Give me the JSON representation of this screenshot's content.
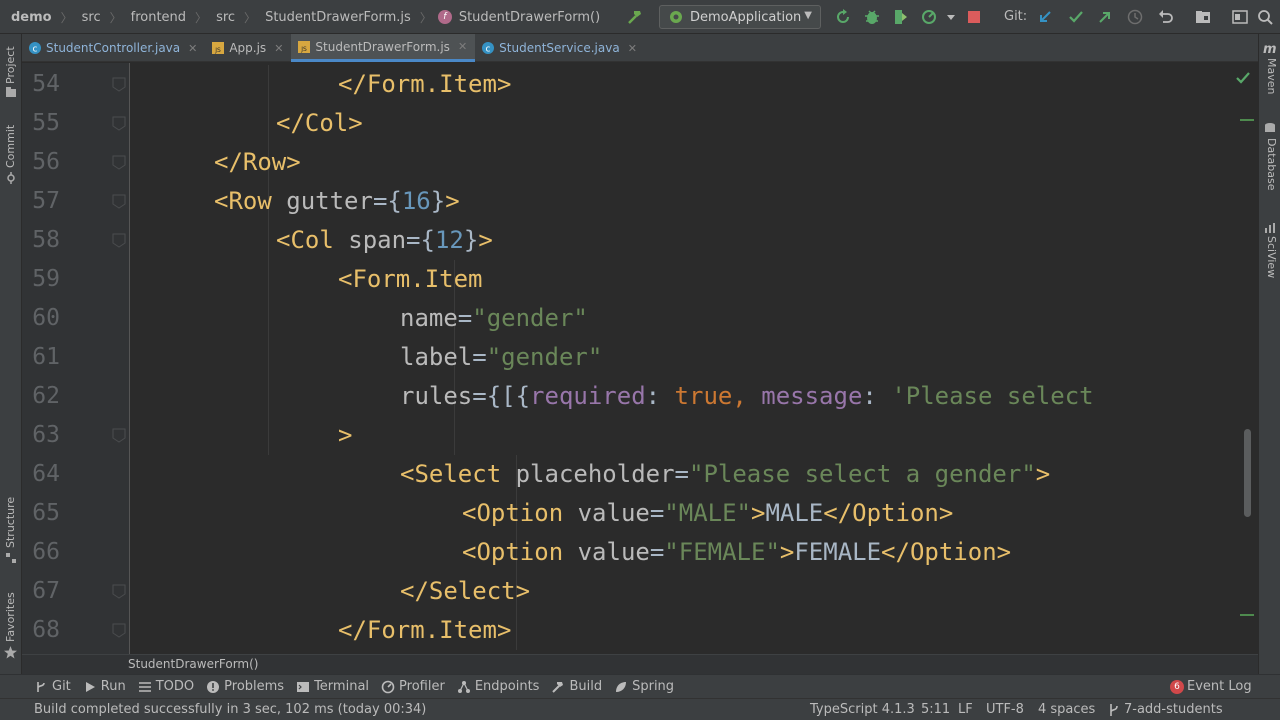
{
  "topbar": {
    "breadcrumb": [
      "demo",
      "src",
      "frontend",
      "src",
      "StudentDrawerForm.js",
      "StudentDrawerForm()"
    ],
    "run_config": "DemoApplication",
    "git_label": "Git:"
  },
  "tabs": [
    {
      "label": "StudentController.java",
      "icon": "java-class-icon",
      "active": false
    },
    {
      "label": "App.js",
      "icon": "js-file-icon",
      "active": false
    },
    {
      "label": "StudentDrawerForm.js",
      "icon": "js-file-icon",
      "active": true
    },
    {
      "label": "StudentService.java",
      "icon": "java-class-icon",
      "active": false
    }
  ],
  "left_tools": [
    "Project",
    "Commit",
    "Structure",
    "Favorites"
  ],
  "right_tools": [
    "Maven",
    "Database",
    "SciView"
  ],
  "editor": {
    "lines": [
      {
        "num": "54",
        "indent": 5,
        "tokens": [
          [
            "t-tag",
            "</Form.Item>"
          ]
        ]
      },
      {
        "num": "55",
        "indent": 4,
        "tokens": [
          [
            "t-tag",
            "</Col>"
          ]
        ]
      },
      {
        "num": "56",
        "indent": 3,
        "tokens": [
          [
            "t-tag",
            "</Row>"
          ]
        ]
      },
      {
        "num": "57",
        "indent": 3,
        "tokens": [
          [
            "t-tag",
            "<Row "
          ],
          [
            "t-attr",
            "gutter"
          ],
          [
            "t-eq",
            "={"
          ],
          [
            "t-num",
            "16"
          ],
          [
            "t-eq",
            "}"
          ],
          [
            "t-tag",
            ">"
          ]
        ]
      },
      {
        "num": "58",
        "indent": 4,
        "tokens": [
          [
            "t-tag",
            "<Col "
          ],
          [
            "t-attr",
            "span"
          ],
          [
            "t-eq",
            "={"
          ],
          [
            "t-num",
            "12"
          ],
          [
            "t-eq",
            "}"
          ],
          [
            "t-tag",
            ">"
          ]
        ]
      },
      {
        "num": "59",
        "indent": 5,
        "tokens": [
          [
            "t-tag",
            "<Form.Item"
          ]
        ]
      },
      {
        "num": "60",
        "indent": 6,
        "tokens": [
          [
            "t-attr",
            "name"
          ],
          [
            "t-eq",
            "="
          ],
          [
            "t-str",
            "\"gender\""
          ]
        ]
      },
      {
        "num": "61",
        "indent": 6,
        "tokens": [
          [
            "t-attr",
            "label"
          ],
          [
            "t-eq",
            "="
          ],
          [
            "t-str",
            "\"gender\""
          ]
        ]
      },
      {
        "num": "62",
        "indent": 6,
        "tokens": [
          [
            "t-attr",
            "rules"
          ],
          [
            "t-eq",
            "={[{"
          ],
          [
            "t-key",
            "required"
          ],
          [
            "t-txt",
            ": "
          ],
          [
            "t-kw",
            "true"
          ],
          [
            "t-kw",
            ", "
          ],
          [
            "t-key",
            "message"
          ],
          [
            "t-txt",
            ": "
          ],
          [
            "t-str",
            "'Please select"
          ]
        ]
      },
      {
        "num": "63",
        "indent": 5,
        "tokens": [
          [
            "t-tag",
            ">"
          ]
        ]
      },
      {
        "num": "64",
        "indent": 6,
        "tokens": [
          [
            "t-tag",
            "<Select "
          ],
          [
            "t-attr",
            "placeholder"
          ],
          [
            "t-eq",
            "="
          ],
          [
            "t-str",
            "\"Please select a gender\""
          ],
          [
            "t-tag",
            ">"
          ]
        ]
      },
      {
        "num": "65",
        "indent": 7,
        "tokens": [
          [
            "t-tag",
            "<Option "
          ],
          [
            "t-attr",
            "value"
          ],
          [
            "t-eq",
            "="
          ],
          [
            "t-str",
            "\"MALE\""
          ],
          [
            "t-tag",
            ">"
          ],
          [
            "t-txt",
            "MALE"
          ],
          [
            "t-tag",
            "</Option>"
          ]
        ]
      },
      {
        "num": "66",
        "indent": 7,
        "tokens": [
          [
            "t-tag",
            "<Option "
          ],
          [
            "t-attr",
            "value"
          ],
          [
            "t-eq",
            "="
          ],
          [
            "t-str",
            "\"FEMALE\""
          ],
          [
            "t-tag",
            ">"
          ],
          [
            "t-txt",
            "FEMALE"
          ],
          [
            "t-tag",
            "</Option>"
          ]
        ]
      },
      {
        "num": "67",
        "indent": 6,
        "tokens": [
          [
            "t-tag",
            "</Select>"
          ]
        ]
      },
      {
        "num": "68",
        "indent": 5,
        "tokens": [
          [
            "t-tag",
            "</Form.Item>"
          ]
        ]
      }
    ],
    "footer_crumb": "StudentDrawerForm()"
  },
  "tool_windows": [
    {
      "label": "Git",
      "icon": "git-branch-icon"
    },
    {
      "label": "Run",
      "icon": "run-icon"
    },
    {
      "label": "TODO",
      "icon": "todo-list-icon"
    },
    {
      "label": "Problems",
      "icon": "problems-icon"
    },
    {
      "label": "Terminal",
      "icon": "terminal-icon"
    },
    {
      "label": "Profiler",
      "icon": "profiler-icon"
    },
    {
      "label": "Endpoints",
      "icon": "endpoints-icon"
    },
    {
      "label": "Build",
      "icon": "build-hammer-icon"
    },
    {
      "label": "Spring",
      "icon": "spring-leaf-icon"
    }
  ],
  "event_log": {
    "label": "Event Log",
    "count": "6"
  },
  "status": {
    "message": "Build completed successfully in 3 sec, 102 ms (today 00:34)",
    "language": "TypeScript 4.1.3",
    "position": "5:11",
    "line_sep": "LF",
    "encoding": "UTF-8",
    "indent": "4 spaces",
    "branch": "7-add-students"
  },
  "colors": {
    "tag": "#e8bf6a",
    "string": "#6a8759",
    "number": "#6897bb",
    "key": "#9876aa",
    "keyword": "#cc7832",
    "accent": "#4a88c7"
  }
}
